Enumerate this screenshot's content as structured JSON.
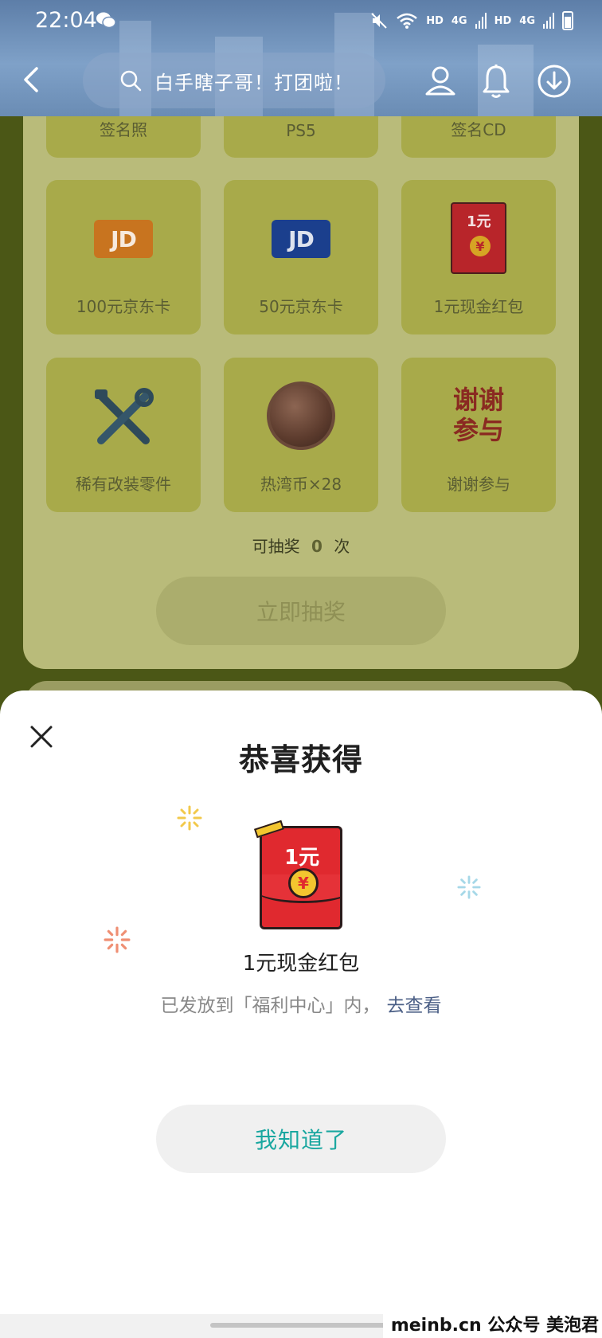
{
  "status_bar": {
    "time": "22:04",
    "network_labels": [
      "HD",
      "4G",
      "HD",
      "4G"
    ]
  },
  "header": {
    "search_text": "白手瞎子哥！打团啦！",
    "icons": [
      "back-icon",
      "search-icon",
      "user-icon",
      "bell-icon",
      "download-icon"
    ]
  },
  "prizes": {
    "top_row": [
      "签名照",
      "PS5",
      "签名CD"
    ],
    "items": [
      {
        "label": "100元京东卡",
        "icon": "jd-card-orange-icon"
      },
      {
        "label": "50元京东卡",
        "icon": "jd-card-blue-icon"
      },
      {
        "label": "1元现金红包",
        "icon": "red-packet-icon",
        "amount": "1元",
        "symbol": "¥"
      },
      {
        "label": "稀有改装零件",
        "icon": "tools-icon"
      },
      {
        "label": "热湾币×28",
        "icon": "coin-icon"
      },
      {
        "label": "谢谢参与",
        "icon": "thanks-icon",
        "icon_text_1": "谢谢",
        "icon_text_2": "参与"
      }
    ]
  },
  "draw": {
    "count_prefix": "可抽奖",
    "count": "0",
    "count_suffix": "次",
    "button_label": "立即抽奖"
  },
  "modal": {
    "title": "恭喜获得",
    "prize_amount": "1元",
    "prize_symbol": "¥",
    "prize_name": "1元现金红包",
    "desc": "已发放到「福利中心」内，",
    "link": "去查看",
    "ack_button": "我知道了"
  },
  "watermark": "meinb.cn 公众号 美泡君",
  "colors": {
    "accent_teal": "#1aa7a0",
    "link_blue": "#4b5f86",
    "red_packet": "#e0292f",
    "overlay_olive": "#4b5716"
  }
}
